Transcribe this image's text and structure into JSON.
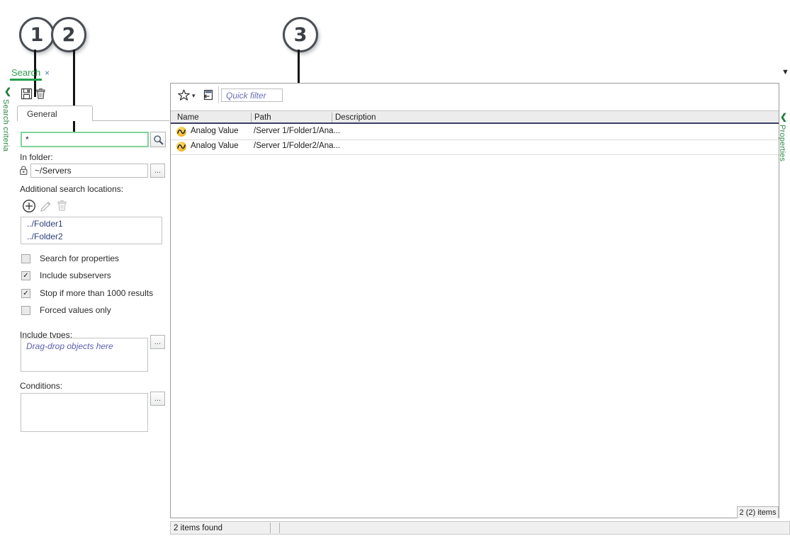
{
  "callouts": [
    {
      "num": "1"
    },
    {
      "num": "2"
    },
    {
      "num": "3"
    }
  ],
  "left_dock": {
    "chevron": "❮",
    "label": "Search criteria"
  },
  "right_dock": {
    "chevron": "❮",
    "label": "Properties"
  },
  "top_right": {
    "chevron": "▼"
  },
  "search_tab": {
    "label": "Search",
    "close": "×"
  },
  "toolbar": {
    "save_title": "Save",
    "delete_title": "Delete"
  },
  "group_tab": {
    "label": "General"
  },
  "criteria": {
    "search_value": "*",
    "search_placeholder": "*",
    "search_button_title": "Search",
    "in_folder_label": "In folder:",
    "in_folder_value": "~/Servers",
    "in_folder_browse": "...",
    "additional_locations_label": "Additional search locations:",
    "add_title": "Add",
    "edit_title": "Edit",
    "remove_title": "Remove",
    "locations": [
      "../Folder1",
      "../Folder2"
    ],
    "checkboxes": [
      {
        "label": "Search for properties",
        "checked": false,
        "mark": ""
      },
      {
        "label": "Include subservers",
        "checked": true,
        "mark": "✓"
      },
      {
        "label": "Stop if more than 1000 results",
        "checked": true,
        "mark": "✓"
      },
      {
        "label": "Forced values only",
        "checked": false,
        "mark": ""
      }
    ],
    "include_types_label": "Include types:",
    "include_types_placeholder": "Drag-drop objects here",
    "include_types_browse": "...",
    "conditions_label": "Conditions:",
    "conditions_value": "",
    "conditions_browse": "..."
  },
  "results": {
    "favorites_title": "Favorites",
    "favorites_caret": "▾",
    "flatview_title": "Flat view",
    "quick_filter_placeholder": "Quick filter",
    "quick_filter_value": "",
    "columns": [
      "Name",
      "Path",
      "Description"
    ],
    "rows": [
      {
        "name": "Analog Value",
        "path": "/Server 1/Folder1/Ana...",
        "description": ""
      },
      {
        "name": "Analog Value",
        "path": "/Server 1/Folder2/Ana...",
        "description": ""
      }
    ],
    "count_badge": "2 (2) items"
  },
  "status": {
    "text": "2 items found"
  }
}
